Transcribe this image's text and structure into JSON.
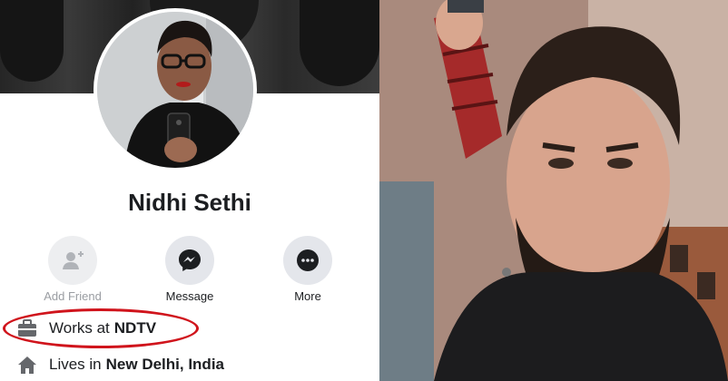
{
  "profile": {
    "name": "Nidhi Sethi",
    "actions": [
      {
        "label": "Add Friend",
        "icon": "add-friend-icon",
        "enabled": false
      },
      {
        "label": "Message",
        "icon": "messenger-icon",
        "enabled": true
      },
      {
        "label": "More",
        "icon": "more-icon",
        "enabled": true
      }
    ],
    "work": {
      "prefix": "Works at",
      "place": "NDTV",
      "icon": "briefcase-icon"
    },
    "lives": {
      "prefix": "Lives in",
      "place": "New Delhi, India",
      "icon": "home-icon"
    }
  },
  "colors": {
    "highlight_ring": "#d0141c",
    "messenger": "#1c1e21",
    "action_bg": "#e4e6eb"
  }
}
